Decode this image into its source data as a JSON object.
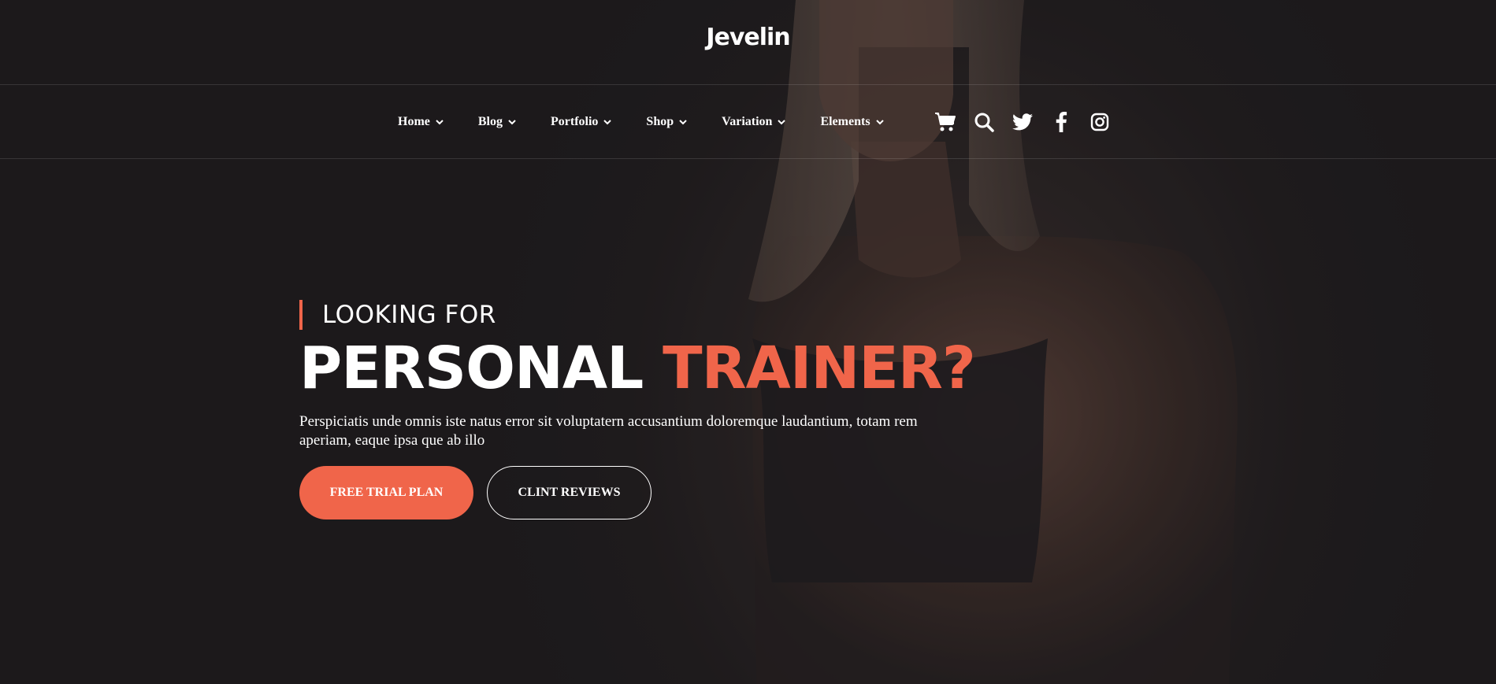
{
  "brand": {
    "logo_text": "Jevelin"
  },
  "nav": {
    "items": [
      {
        "label": "Home"
      },
      {
        "label": "Blog"
      },
      {
        "label": "Portfolio"
      },
      {
        "label": "Shop"
      },
      {
        "label": "Variation"
      },
      {
        "label": "Elements"
      }
    ],
    "icons": [
      "cart-icon",
      "search-icon",
      "twitter-icon",
      "facebook-icon",
      "instagram-icon"
    ]
  },
  "hero": {
    "eyebrow": "LOOKING FOR",
    "headline_main": "PERSONAL",
    "headline_accent": "TRAINER?",
    "description": "Perspiciatis unde omnis iste natus error sit voluptatern accusantium doloremque laudantium, totam rem aperiam, eaque ipsa que ab illo",
    "primary_button": "FREE TRIAL PLAN",
    "secondary_button": "CLINT REVIEWS"
  },
  "colors": {
    "accent": "#f0654a",
    "background": "#1d1b1c",
    "text": "#ffffff"
  }
}
